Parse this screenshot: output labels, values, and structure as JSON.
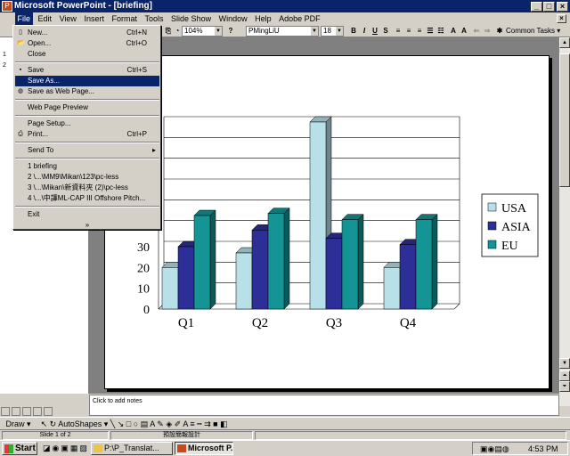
{
  "window": {
    "title": "Microsoft PowerPoint - [briefing]"
  },
  "menubar": {
    "items": [
      "File",
      "Edit",
      "View",
      "Insert",
      "Format",
      "Tools",
      "Slide Show",
      "Window",
      "Help",
      "Adobe PDF"
    ]
  },
  "toolbar": {
    "zoom": "104%",
    "font": "PMingLiU",
    "size": "18",
    "common_tasks": "Common Tasks"
  },
  "file_menu": {
    "new": {
      "label": "New...",
      "shortcut": "Ctrl+N"
    },
    "open": {
      "label": "Open...",
      "shortcut": "Ctrl+O"
    },
    "close": {
      "label": "Close"
    },
    "save": {
      "label": "Save",
      "shortcut": "Ctrl+S"
    },
    "save_as": {
      "label": "Save As..."
    },
    "save_web": {
      "label": "Save as Web Page..."
    },
    "web_preview": {
      "label": "Web Page Preview"
    },
    "page_setup": {
      "label": "Page Setup..."
    },
    "print": {
      "label": "Print...",
      "shortcut": "Ctrl+P"
    },
    "send_to": {
      "label": "Send To"
    },
    "recent": [
      "1 briefing",
      "2 \\...\\MM9\\Mikan\\123\\pc-less",
      "3 \\...\\Mikan\\新資料夾 (2)\\pc-less",
      "4 \\...\\中譯ML-CAP III Offshore Pitch..."
    ],
    "exit": {
      "label": "Exit"
    },
    "more": "»"
  },
  "outline": {
    "slide_numbers": [
      "1",
      "2"
    ]
  },
  "notes": {
    "placeholder": "Click to add notes"
  },
  "drawbar": {
    "draw": "Draw",
    "autoshapes": "AutoShapes"
  },
  "status": {
    "slide": "Slide 1 of 2",
    "design": "預設簡報設計"
  },
  "taskbar": {
    "start": "Start",
    "tasks": [
      "P:\\P_Translat...",
      "Microsoft P..."
    ],
    "clock": "4:53 PM"
  },
  "chart_data": {
    "type": "bar",
    "categories": [
      "Q1",
      "Q2",
      "Q3",
      "Q4"
    ],
    "series": [
      {
        "name": "USA",
        "values": [
          20,
          27,
          90,
          20
        ],
        "color": "#b8e0e8"
      },
      {
        "name": "ASIA",
        "values": [
          30,
          38,
          34,
          31
        ],
        "color": "#2e2e99"
      },
      {
        "name": "EU",
        "values": [
          45,
          46,
          43,
          43
        ],
        "color": "#149494"
      }
    ],
    "y_ticks": [
      "0",
      "10",
      "20",
      "30",
      "40"
    ],
    "ylim": [
      0,
      90
    ],
    "grid": true,
    "legend": "right"
  }
}
